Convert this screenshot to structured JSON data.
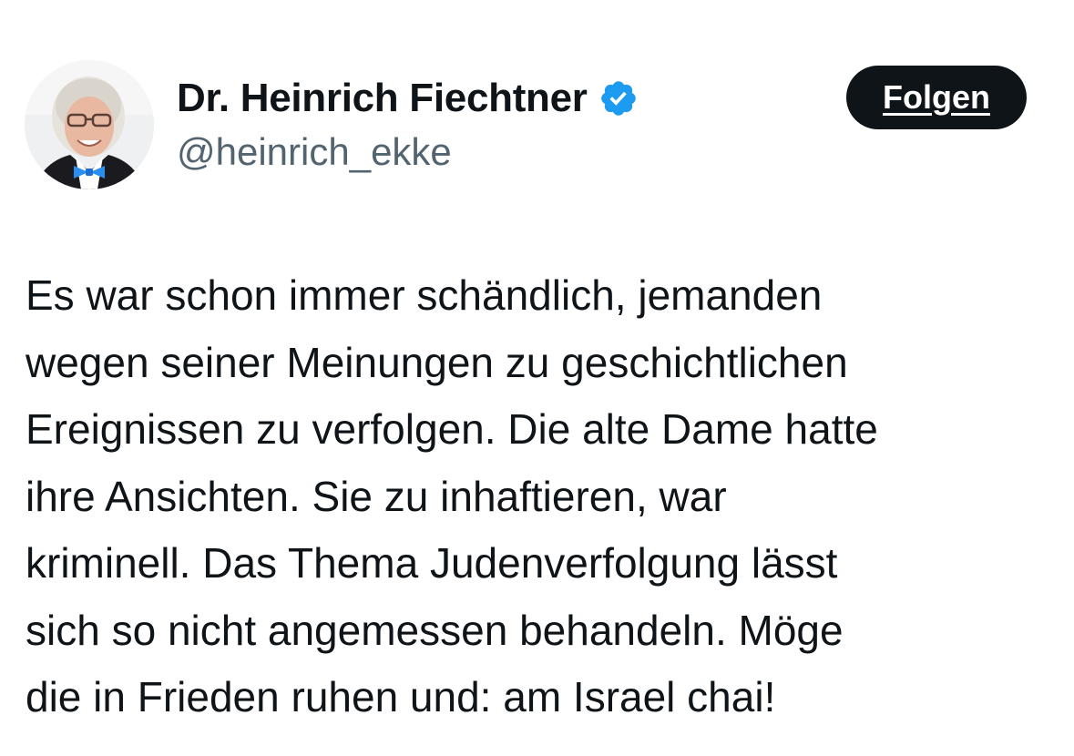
{
  "author": {
    "display_name": "Dr. Heinrich Fiechtner",
    "handle": "@heinrich_ekke",
    "verified": true,
    "verified_icon": "verified-badge-icon",
    "avatar_icon": "profile-photo"
  },
  "actions": {
    "follow_label": "Folgen"
  },
  "tweet": {
    "text": "Es war schon immer schändlich, jemanden\nwegen seiner Meinungen zu geschichtlichen\nEreignissen zu verfolgen. Die alte Dame hatte\nihre Ansichten. Sie zu inhaftieren, war\nkriminell. Das Thema Judenverfolgung lässt\nsich so nicht angemessen behandeln. Möge\ndie in Frieden ruhen und: am Israel chai!"
  },
  "colors": {
    "text_primary": "#0f1419",
    "text_secondary": "#536471",
    "verified_blue": "#1d9bf0",
    "button_bg": "#0f1419",
    "button_text": "#ffffff",
    "background": "#ffffff"
  }
}
